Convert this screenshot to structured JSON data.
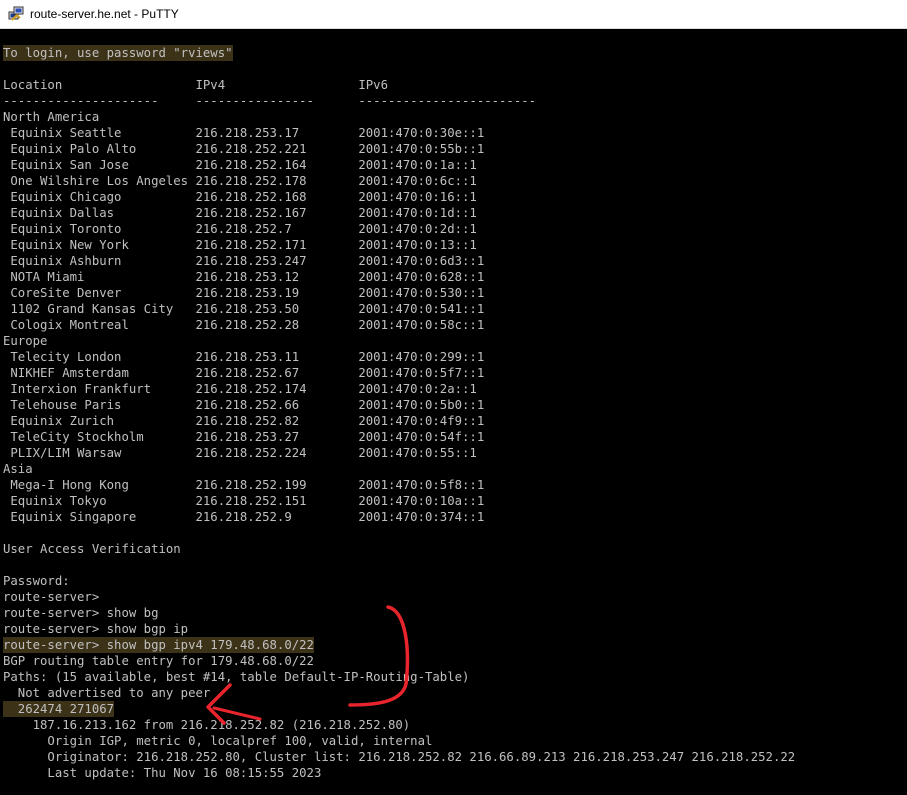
{
  "window": {
    "title": "route-server.he.net - PuTTY",
    "icon": "putty-icon"
  },
  "terminal": {
    "highlight_color": "#3c3218",
    "annotation_color": "#e8242c",
    "lines": [
      "To login, use password \"rviews\"",
      "",
      "Location                  IPv4                  IPv6",
      "---------------------     ----------------      ------------------------",
      "North America",
      " Equinix Seattle          216.218.253.17        2001:470:0:30e::1",
      " Equinix Palo Alto        216.218.252.221       2001:470:0:55b::1",
      " Equinix San Jose         216.218.252.164       2001:470:0:1a::1",
      " One Wilshire Los Angeles 216.218.252.178       2001:470:0:6c::1",
      " Equinix Chicago          216.218.252.168       2001:470:0:16::1",
      " Equinix Dallas           216.218.252.167       2001:470:0:1d::1",
      " Equinix Toronto          216.218.252.7         2001:470:0:2d::1",
      " Equinix New York         216.218.252.171       2001:470:0:13::1",
      " Equinix Ashburn          216.218.253.247       2001:470:0:6d3::1",
      " NOTA Miami               216.218.253.12        2001:470:0:628::1",
      " CoreSite Denver          216.218.253.19        2001:470:0:530::1",
      " 1102 Grand Kansas City   216.218.253.50        2001:470:0:541::1",
      " Cologix Montreal         216.218.252.28        2001:470:0:58c::1",
      "Europe",
      " Telecity London          216.218.253.11        2001:470:0:299::1",
      " NIKHEF Amsterdam         216.218.252.67        2001:470:0:5f7::1",
      " Interxion Frankfurt      216.218.252.174       2001:470:0:2a::1",
      " Telehouse Paris          216.218.252.66        2001:470:0:5b0::1",
      " Equinix Zurich           216.218.252.82        2001:470:0:4f9::1",
      " TeleCity Stockholm       216.218.253.27        2001:470:0:54f::1",
      " PLIX/LIM Warsaw          216.218.252.224       2001:470:0:55::1",
      "Asia",
      " Mega-I Hong Kong         216.218.252.199       2001:470:0:5f8::1",
      " Equinix Tokyo            216.218.252.151       2001:470:0:10a::1",
      " Equinix Singapore        216.218.252.9         2001:470:0:374::1",
      "",
      "User Access Verification",
      "",
      "Password:",
      "route-server>",
      "route-server> show bg",
      "route-server> show bgp ip",
      "route-server> show bgp ipv4 179.48.68.0/22",
      "BGP routing table entry for 179.48.68.0/22",
      "Paths: (15 available, best #14, table Default-IP-Routing-Table)",
      "  Not advertised to any peer",
      "  262474 271067",
      "    187.16.213.162 from 216.218.252.82 (216.218.252.80)",
      "      Origin IGP, metric 0, localpref 100, valid, internal",
      "      Originator: 216.218.252.80, Cluster list: 216.218.252.82 216.66.89.213 216.218.253.247 216.218.252.22",
      "      Last update: Thu Nov 16 08:15:55 2023"
    ]
  }
}
